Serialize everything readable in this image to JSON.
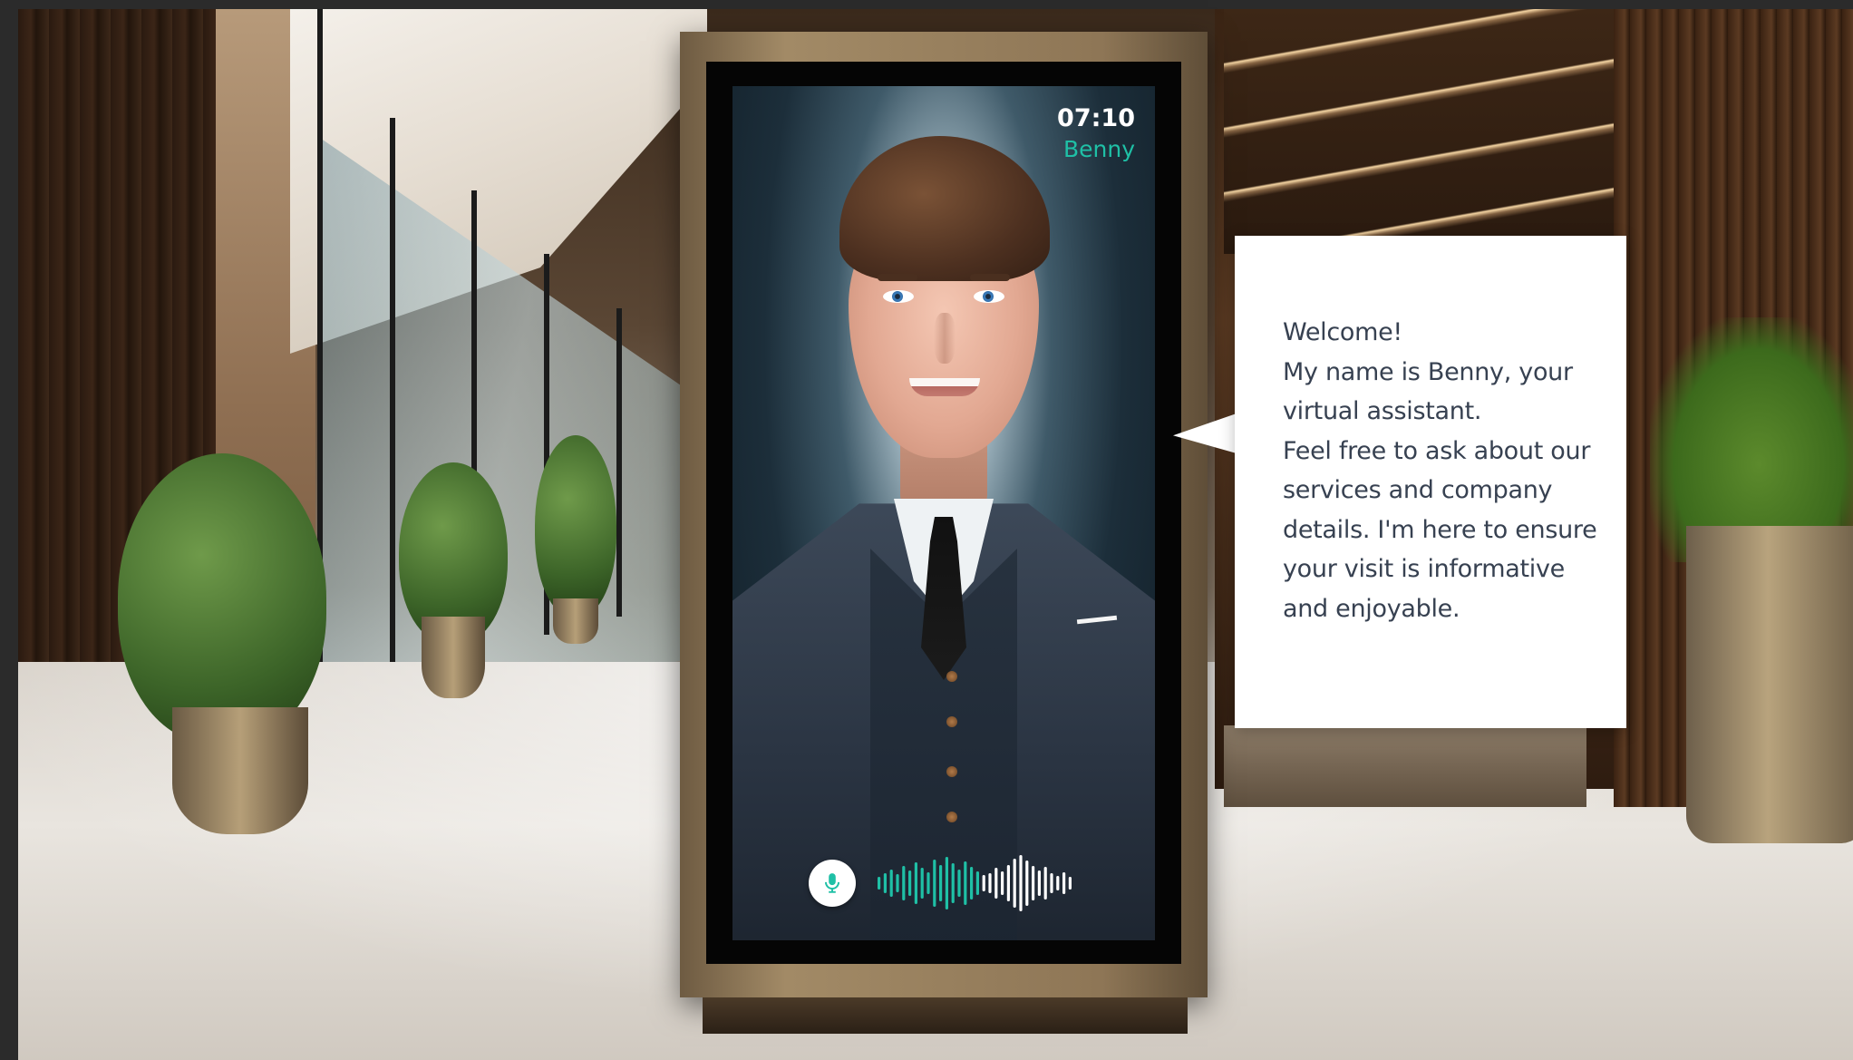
{
  "kiosk": {
    "time": "07:10",
    "assistant_name": "Benny",
    "mic_icon": "microphone-icon",
    "waveform_icon": "audio-waveform-icon",
    "accent_color": "#1fc0a6"
  },
  "speech_bubble": {
    "lines": [
      "Welcome!",
      "My name is Benny, your",
      "virtual assistant.",
      "Feel free to ask about our",
      "services and company",
      "details. I'm here to ensure",
      "your visit is informative",
      "and enjoyable."
    ]
  }
}
